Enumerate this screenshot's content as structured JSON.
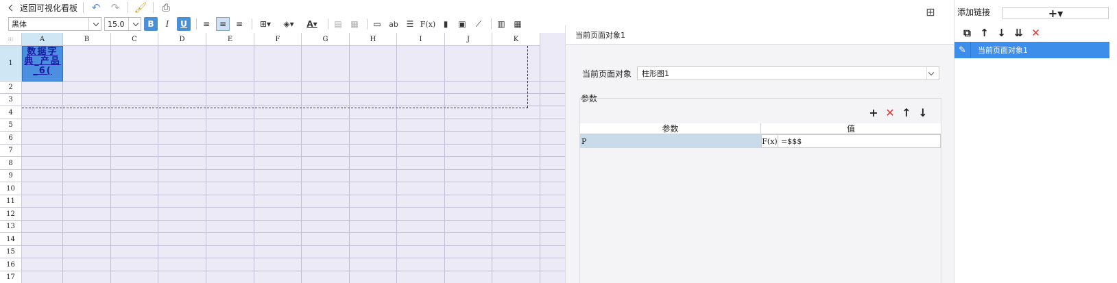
{
  "toolbar": {
    "back_label": "返回可视化看板",
    "icons": [
      "undo-icon",
      "redo-icon",
      "format-brush-icon",
      "preview-icon"
    ]
  },
  "format": {
    "font_name": "黑体",
    "font_size": "15.0",
    "bold": "B",
    "italic": "I",
    "underline": "U",
    "text_ab": "ab",
    "fx": "F(x)"
  },
  "sheet": {
    "columns": [
      "A",
      "B",
      "C",
      "D",
      "E",
      "F",
      "G",
      "H",
      "I",
      "J",
      "K"
    ],
    "rows": [
      "1",
      "2",
      "3",
      "4",
      "5",
      "6",
      "7",
      "8",
      "9",
      "10",
      "11",
      "12",
      "13",
      "14",
      "15",
      "16",
      "17"
    ],
    "a1_text": "数据字典_产品_6("
  },
  "middle": {
    "title": "当前页面对象1",
    "object_label": "当前页面对象",
    "object_value": "柱形图1",
    "param_section": "参数",
    "table_headers": [
      "参数",
      "值"
    ],
    "param_name": "P",
    "param_fx": "F(x)",
    "param_value": "=$$$"
  },
  "right": {
    "add_link_label": "添加链接",
    "add_btn": "+▾",
    "link_item": "当前页面对象1"
  },
  "colors": {
    "accent": "#3d8eea",
    "sheet_bg": "#eceaf6",
    "selected_cell": "#4a8fe0",
    "delete_red": "#e03030"
  }
}
